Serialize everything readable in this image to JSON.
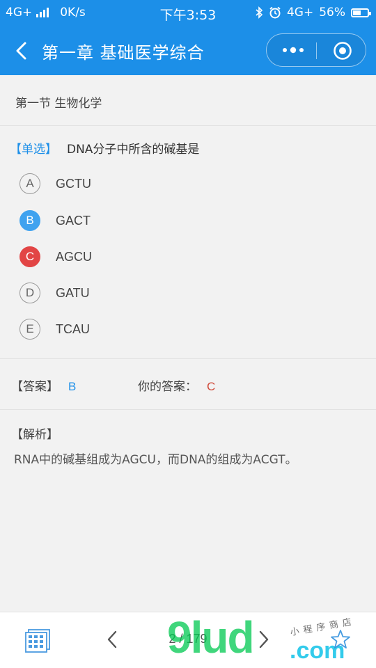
{
  "status_bar": {
    "network": "4G+",
    "speed": "0K/s",
    "time": "下午3:53",
    "network_right": "4G+",
    "battery": "56%",
    "battery_level": 0.56
  },
  "nav": {
    "title": "第一章 基础医学综合"
  },
  "section": {
    "title": "第一节 生物化学"
  },
  "question": {
    "type": "【单选】",
    "text": "DNA分子中所含的碱基是",
    "options": [
      {
        "letter": "A",
        "text": "GCTU",
        "state": "normal"
      },
      {
        "letter": "B",
        "text": "GACT",
        "state": "correct"
      },
      {
        "letter": "C",
        "text": "AGCU",
        "state": "wrong"
      },
      {
        "letter": "D",
        "text": "GATU",
        "state": "normal"
      },
      {
        "letter": "E",
        "text": "TCAU",
        "state": "normal"
      }
    ]
  },
  "answer": {
    "label": "【答案】",
    "correct": "B",
    "your_label": "你的答案：",
    "your_answer": "C"
  },
  "analysis": {
    "label": "【解析】",
    "text": "RNA中的碱基组成为AGCU，而DNA的组成为ACGT。"
  },
  "pager": {
    "counter": "2 / 179"
  },
  "watermark": {
    "brand": "9lud",
    "domain": ".com",
    "tagline": "小程序商店"
  },
  "colors": {
    "primary": "#1c8fe8",
    "correct": "#3fa2ef",
    "wrong": "#e24545"
  }
}
